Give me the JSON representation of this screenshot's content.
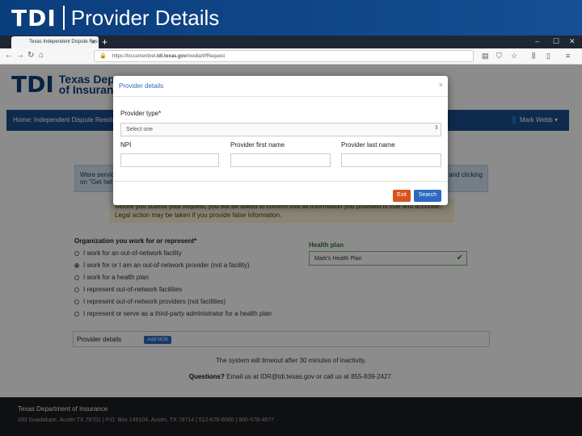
{
  "slide": {
    "logo": "TDI",
    "title": "Provider Details"
  },
  "browser": {
    "tab_title": "Texas Independent Dispute Res",
    "tab_close": "×",
    "new_tab": "+",
    "url_prefix": "https://txcssmentnet.",
    "url_domain": "tdi.texas.gov",
    "url_path": "/media/trfRequest",
    "icons": [
      "back-icon",
      "forward-icon",
      "reload-icon",
      "home-icon",
      "lock-icon",
      "bookmark-icon",
      "menu-icon"
    ]
  },
  "site": {
    "logo_mark": "TDI",
    "logo_line1": "Texas Department",
    "logo_line2": "of Insurance",
    "nav_text": "Home: Independent Dispute Resolution",
    "user": "Mark Webb ▾",
    "info_left": "Were services",
    "info_left_2": "on \"Get hel",
    "info_right": "and clicking",
    "warn_line1": "Before you submit your request, you will be asked to confirm that all information you provided is true and accurate.",
    "warn_line2": "Legal action may be taken if you provide false information.",
    "org_title": "Organization you work for or represent*",
    "org_options": [
      "I work for an out-of-network facility",
      "I work for or I am an out-of-network provider (not a facility)",
      "I work for a health plan",
      "I represent out-of-network facilities",
      "I represent out-of-network providers (not facilities)",
      "I represent or serve as a third-party administrator for a health plan"
    ],
    "org_selected_index": 1,
    "health_plan_label": "Health plan",
    "health_plan_value": "Mark's Health Plan",
    "provider_details_label": "Provider details",
    "add_button": "Add NGB",
    "timeout_text": "The system will timeout after 30 minutes of inactivity.",
    "questions_lead": "Questions?",
    "questions_text": " Email us at ",
    "questions_email": "IDR@tdi.texas.gov",
    "questions_tail": " or call us at 855-839-2427.",
    "footer_title": "Texas Department of Insurance",
    "footer_address": "333 Guadalupe, Austin TX 78701 | P.O. Box 149104, Austin, TX 78714 | 512-676-6000 | 800-578-4677"
  },
  "modal": {
    "title": "Provider details",
    "close": "×",
    "provider_type_label": "Provider type*",
    "provider_type_value": "Select one",
    "npi_label": "NPI",
    "first_name_label": "Provider first name",
    "last_name_label": "Provider last name",
    "exit_label": "Exit",
    "search_label": "Search"
  },
  "colors": {
    "brand": "#0d3f7a",
    "primary_button": "#2a6ac2",
    "exit_button": "#d9531e"
  }
}
